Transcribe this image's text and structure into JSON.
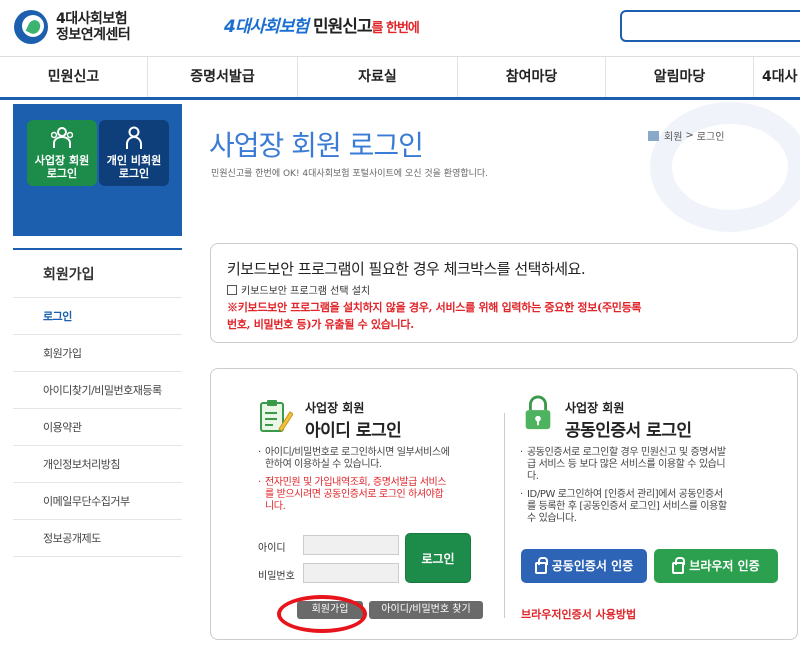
{
  "header": {
    "logo_line1": "4대사회보험",
    "logo_line2": "정보연계센터",
    "slogan_part1": "4대사회보험",
    "slogan_part2": "민원신고",
    "slogan_part3": "를 한번에"
  },
  "gnb": [
    "민원신고",
    "증명서발급",
    "자료실",
    "참여마당",
    "알림마당",
    "4대사"
  ],
  "login_types": {
    "business": "사업장 회원\n로그인",
    "business_l1": "사업장 회원",
    "business_l2": "로그인",
    "personal_l1": "개인 비회원",
    "personal_l2": "로그인"
  },
  "sidebar": {
    "title": "회원가입",
    "items": [
      "로그인",
      "회원가입",
      "아이디찾기/비밀번호재등록",
      "이용약관",
      "개인정보처리방침",
      "이메일무단수집거부",
      "정보공개제도"
    ]
  },
  "page": {
    "title": "사업장 회원 로그인",
    "subtitle": "민원신고를 한번에 OK! 4대사회보험 포털사이트에 오신 것을 환영합니다.",
    "breadcrumb": [
      "회원",
      "로그인"
    ]
  },
  "keyboard": {
    "title": "키보드보안 프로그램이 필요한 경우 체크박스를 선택하세요.",
    "checkbox_label": "키보드보안 프로그램 선택 설치",
    "warning_line1": "※키보드보안 프로그램을 설치하지 않을 경우, 서비스를 위해 입력하는 중요한 정보(주민등록",
    "warning_line2": "번호, 비밀번호 등)가 유출될 수 있습니다."
  },
  "id_login": {
    "sub": "사업장 회원",
    "main": "아이디 로그인",
    "desc1_l1": "아이디/비밀번호로 로그인하시면 일부서비스에",
    "desc1_l2": "한하여 이용하실 수 있습니다.",
    "desc2_l1": "전자민원 및 가입내역조회, 증명서발급 서비스",
    "desc2_l2": "를 받으시려면 공동인증서로 로그인 하셔야합",
    "desc2_l3": "니다.",
    "id_label": "아이디",
    "pw_label": "비밀번호",
    "login_button": "로그인",
    "join_button": "회원가입",
    "find_button": "아이디/비밀번호 찾기"
  },
  "cert_login": {
    "sub": "사업장 회원",
    "main": "공동인증서 로그인",
    "desc1_l1": "공동인증서로 로그인할 경우 민원신고 및 증명서발",
    "desc1_l2": "급 서비스 등 보다 많은 서비스를 이용할 수 있습니",
    "desc1_l3": "다.",
    "desc2_l1": "ID/PW 로그인하여 [인증서 관리]에서 공동인증서",
    "desc2_l2": "를 등록한 후 [공동인증서 로그인] 서비스를 이용할",
    "desc2_l3": "수 있습니다.",
    "cert_button": "공동인증서 인증",
    "browser_button": "브라우저 인증",
    "howto": "브라우저인증서 사용방법"
  },
  "colors": {
    "brand_blue": "#1b5fae",
    "green": "#1d8c4a",
    "red": "#e0262b"
  }
}
